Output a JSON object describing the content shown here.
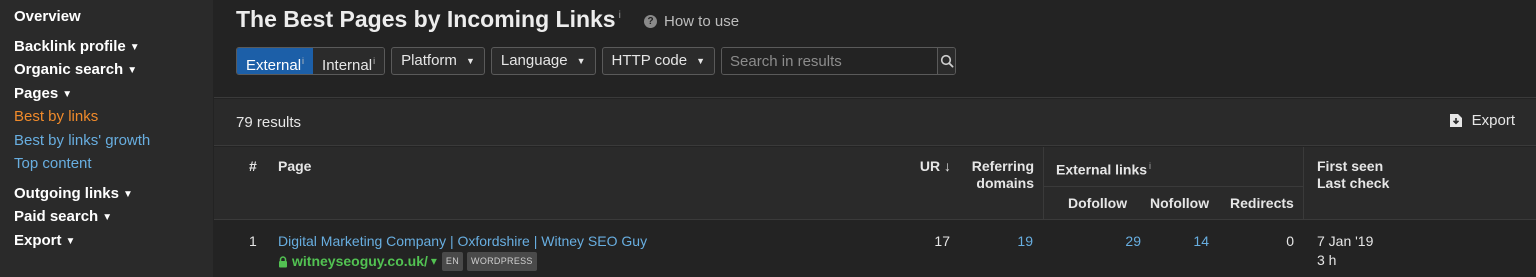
{
  "sidebar": {
    "overview": "Overview",
    "backlink_profile": "Backlink profile",
    "organic_search": "Organic search",
    "pages": "Pages",
    "best_by_links": "Best by links",
    "best_by_links_growth": "Best by links' growth",
    "top_content": "Top content",
    "outgoing_links": "Outgoing links",
    "paid_search": "Paid search",
    "export": "Export",
    "caret": "▼"
  },
  "header": {
    "title": "The Best Pages by Incoming Links",
    "title_info": "i",
    "how_to_use": "How to use",
    "help_icon_glyph": "?"
  },
  "filters": {
    "external": "External",
    "external_info": "i",
    "internal": "Internal",
    "internal_info": "i",
    "platform": "Platform",
    "language": "Language",
    "http_code": "HTTP code",
    "dropdown_glyph": "▼",
    "search_placeholder": "Search in results"
  },
  "results": {
    "count": "79 results",
    "export": "Export"
  },
  "table": {
    "columns": {
      "index": "#",
      "page": "Page",
      "ur": "UR",
      "ur_sort": "↓",
      "referring_domains_1": "Referring",
      "referring_domains_2": "domains",
      "external_links": "External links",
      "external_links_info": "i",
      "dofollow": "Dofollow",
      "nofollow": "Nofollow",
      "redirects": "Redirects",
      "first_seen": "First seen",
      "last_check": "Last check"
    },
    "rows": [
      {
        "index": "1",
        "title": "Digital Marketing Company | Oxfordshire | Witney SEO Guy",
        "url": "witneyseoguy.co.uk/",
        "url_caret": "▾",
        "lang_badge": "EN",
        "platform_badge": "WORDPRESS",
        "ur": "17",
        "referring_domains": "19",
        "dofollow": "29",
        "nofollow": "14",
        "redirects": "0",
        "first_seen": "7 Jan '19",
        "last_check": "3 h"
      }
    ]
  },
  "colors": {
    "accent_blue": "#1c5fa8",
    "link_blue": "#68aee0",
    "active_orange": "#f08a2a",
    "url_green": "#52c252"
  },
  "icons": {
    "help": "question-circle-icon",
    "search": "search-icon",
    "export": "export-download-icon",
    "lock": "lock-icon"
  }
}
